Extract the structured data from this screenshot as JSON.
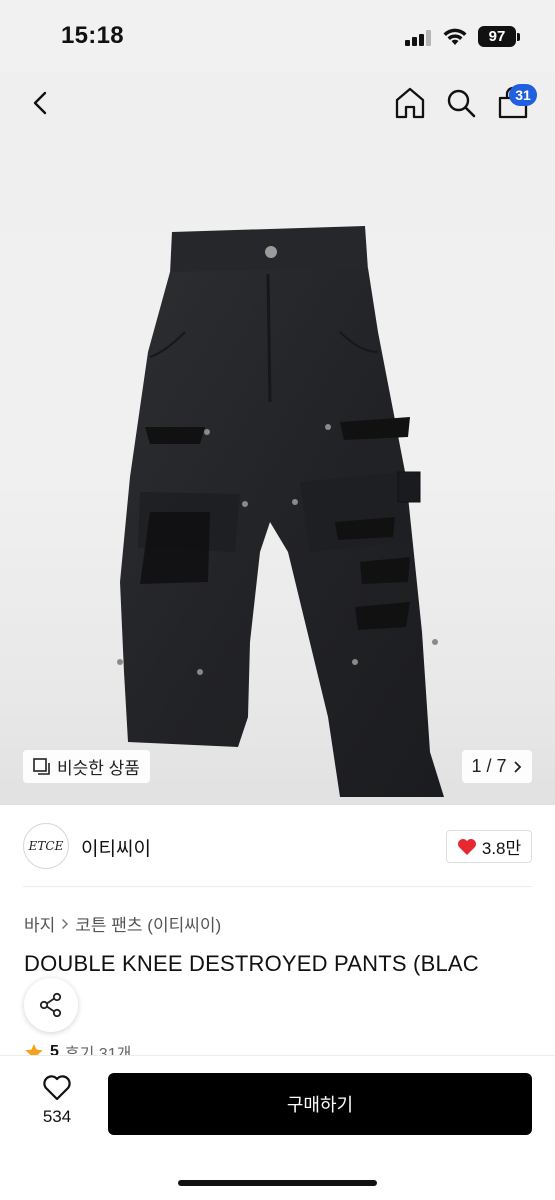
{
  "status_bar": {
    "time": "15:18",
    "battery": "97"
  },
  "nav": {
    "cart_count": "31"
  },
  "gallery": {
    "similar_label": "비슷한 상품",
    "counter": "1 / 7"
  },
  "brand": {
    "logo_text": "ETCE",
    "name": "이티씨이",
    "likes": "3.8만"
  },
  "breadcrumb": {
    "level1": "바지",
    "level2": "코튼 팬츠 (이티씨이)"
  },
  "product": {
    "title": "DOUBLE KNEE DESTROYED PANTS (BLAC"
  },
  "rating": {
    "score": "5",
    "reviews": "후기 31개"
  },
  "actions": {
    "wish_count": "534",
    "buy_label": "구매하기"
  },
  "colors": {
    "accent": "#1f5fe0",
    "heart": "#e8282f",
    "star": "#f4a21b"
  }
}
